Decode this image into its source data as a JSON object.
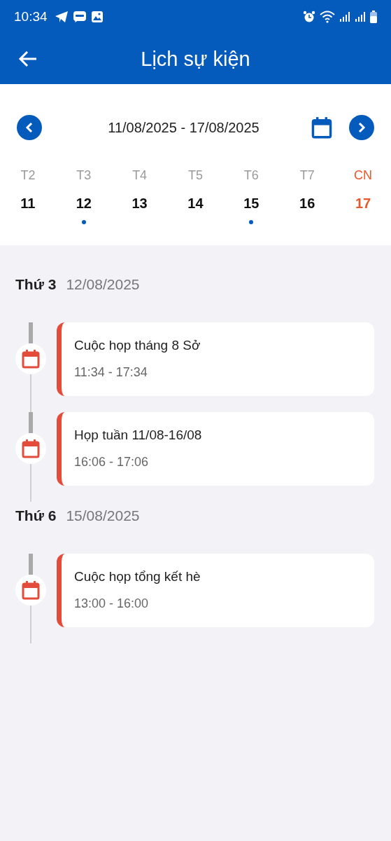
{
  "status_bar": {
    "time": "10:34"
  },
  "app_bar": {
    "title": "Lịch sự kiện"
  },
  "week": {
    "range": "11/08/2025 - 17/08/2025",
    "days": [
      {
        "label": "T2",
        "date": "11",
        "kind": "weekday",
        "has_event": false
      },
      {
        "label": "T3",
        "date": "12",
        "kind": "weekday",
        "has_event": true
      },
      {
        "label": "T4",
        "date": "13",
        "kind": "weekday",
        "has_event": false
      },
      {
        "label": "T5",
        "date": "14",
        "kind": "weekday",
        "has_event": false
      },
      {
        "label": "T6",
        "date": "15",
        "kind": "weekday",
        "has_event": true
      },
      {
        "label": "T7",
        "date": "16",
        "kind": "weekday",
        "has_event": false
      },
      {
        "label": "CN",
        "date": "17",
        "kind": "sunday",
        "has_event": false
      }
    ]
  },
  "groups": [
    {
      "weekday": "Thứ 3",
      "date": "12/08/2025",
      "events": [
        {
          "title": "Cuộc họp tháng 8 Sở",
          "time": "11:34 - 17:34"
        },
        {
          "title": "Họp tuần 11/08-16/08",
          "time": "16:06 - 17:06"
        }
      ]
    },
    {
      "weekday": "Thứ 6",
      "date": "15/08/2025",
      "events": [
        {
          "title": "Cuộc họp tổng kết hè",
          "time": "13:00 - 16:00"
        }
      ]
    }
  ]
}
